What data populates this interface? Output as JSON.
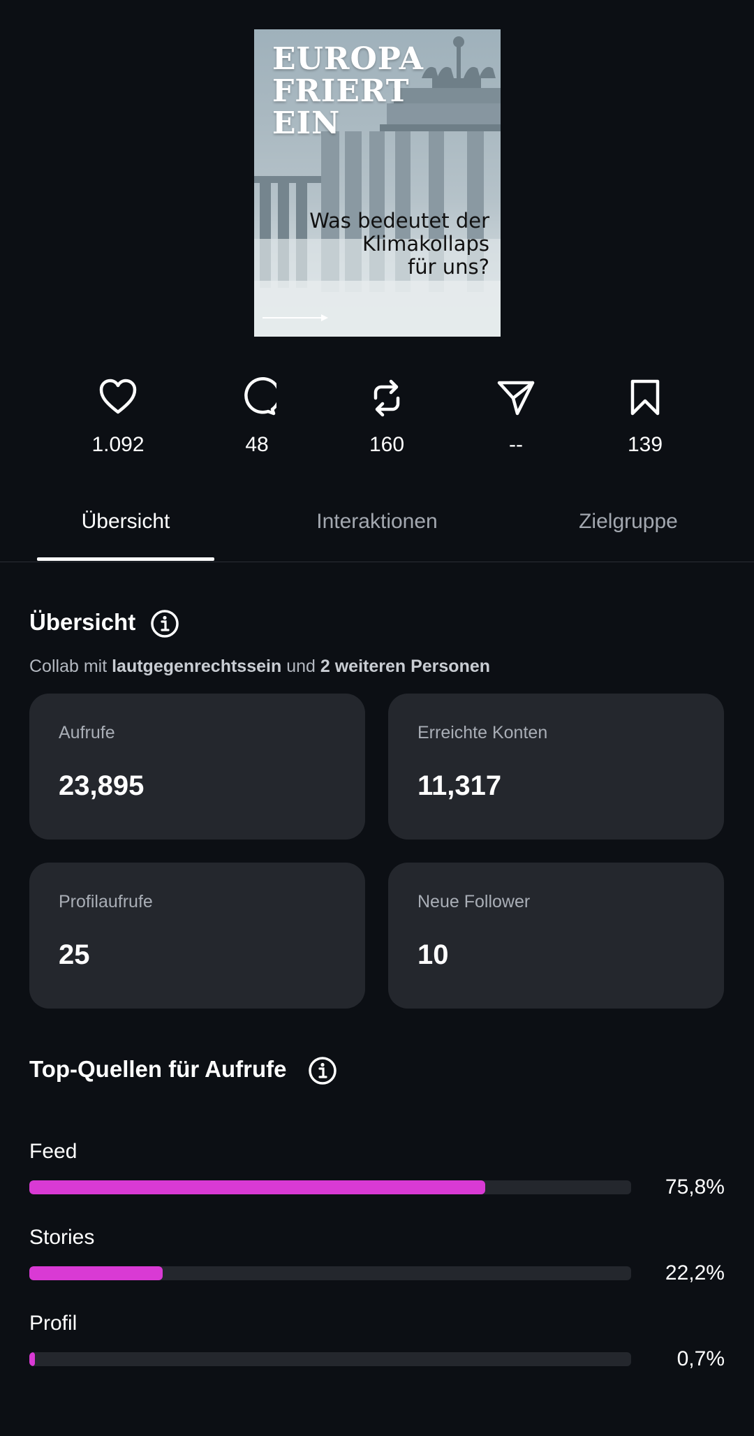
{
  "post": {
    "title_lines": [
      "EUROPA",
      "FRIERT",
      "EIN"
    ],
    "subtitle_lines": [
      "Was bedeutet der",
      "Klimakollaps",
      "für uns?"
    ]
  },
  "metrics": [
    {
      "icon": "heart-icon",
      "value": "1.092"
    },
    {
      "icon": "comment-icon",
      "value": "48"
    },
    {
      "icon": "repost-icon",
      "value": "160"
    },
    {
      "icon": "share-icon",
      "value": "--"
    },
    {
      "icon": "bookmark-icon",
      "value": "139"
    }
  ],
  "tabs": [
    {
      "label": "Übersicht",
      "active": true
    },
    {
      "label": "Interaktionen",
      "active": false
    },
    {
      "label": "Zielgruppe",
      "active": false
    }
  ],
  "overview": {
    "title": "Übersicht",
    "collab_prefix": "Collab mit",
    "collab_user": "lautgegenrechtssein",
    "collab_and": "und",
    "collab_others": "2 weiteren Personen",
    "cards": [
      {
        "label": "Aufrufe",
        "value": "23,895"
      },
      {
        "label": "Erreichte Konten",
        "value": "11,317"
      },
      {
        "label": "Profilaufrufe",
        "value": "25"
      },
      {
        "label": "Neue Follower",
        "value": "10"
      }
    ]
  },
  "sources": {
    "title": "Top-Quellen für Aufrufe",
    "accent_color": "#d93ad4",
    "items": [
      {
        "label": "Feed",
        "percent_text": "75,8%",
        "percent": 75.8
      },
      {
        "label": "Stories",
        "percent_text": "22,2%",
        "percent": 22.2
      },
      {
        "label": "Profil",
        "percent_text": "0,7%",
        "percent": 0.7
      }
    ]
  }
}
